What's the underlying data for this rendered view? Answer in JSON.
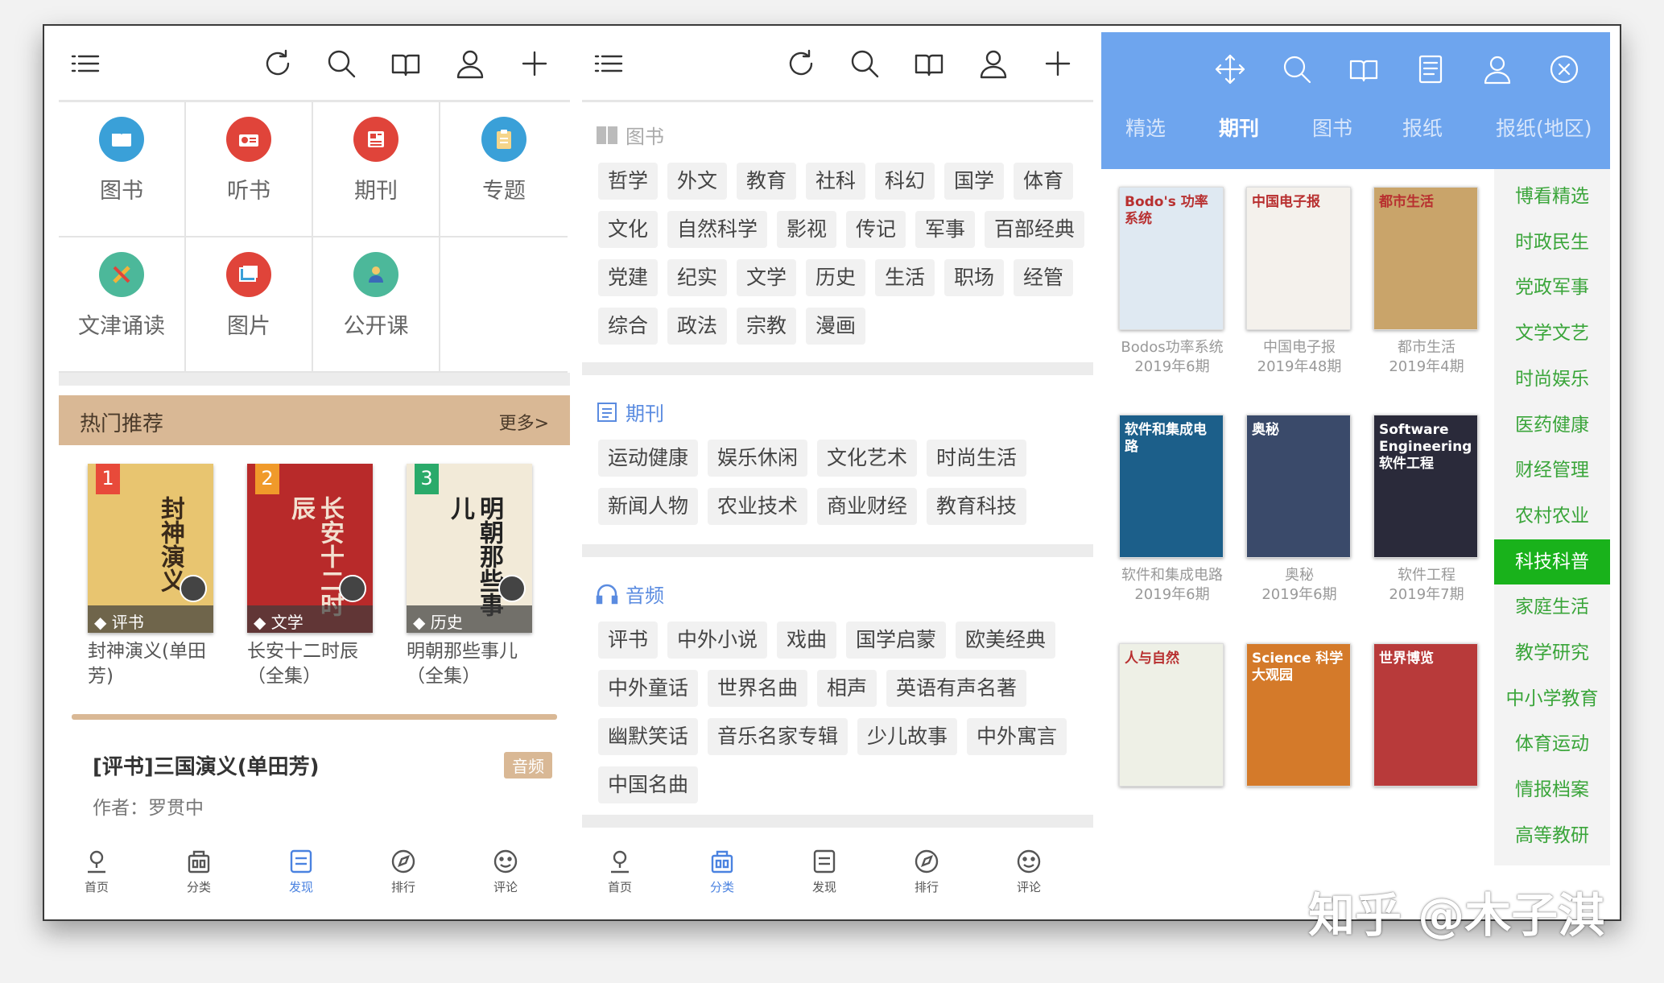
{
  "panel1": {
    "grid": [
      {
        "label": "图书",
        "color": "#3aa0d8",
        "icon": "book-icon"
      },
      {
        "label": "听书",
        "color": "#e0443a",
        "icon": "radio-icon"
      },
      {
        "label": "期刊",
        "color": "#e0443a",
        "icon": "newspaper-icon"
      },
      {
        "label": "专题",
        "color": "#3aa0d8",
        "icon": "clipboard-icon"
      },
      {
        "label": "文津诵读",
        "color": "#4cb89a",
        "icon": "brush-icon"
      },
      {
        "label": "图片",
        "color": "#e0443a",
        "icon": "picture-icon"
      },
      {
        "label": "公开课",
        "color": "#4cb89a",
        "icon": "teacher-icon"
      }
    ],
    "hot": {
      "title": "热门推荐",
      "more": "更多>"
    },
    "books": [
      {
        "rank": "1",
        "tag": "评书",
        "title": "封神演义(单田芳)",
        "cover_text": "封神演义",
        "rank_color": "#e84a3a",
        "cover_color": "#e8c570"
      },
      {
        "rank": "2",
        "tag": "文学",
        "title": "长安十二时辰（全集）",
        "cover_text": "长安十二时辰",
        "rank_color": "#f09a2a",
        "cover_color": "#b82a2a"
      },
      {
        "rank": "3",
        "tag": "历史",
        "title": "明朝那些事儿（全集）",
        "cover_text": "明朝那些事儿",
        "rank_color": "#2aaa6a",
        "cover_color": "#f2ead8"
      }
    ],
    "featured": {
      "title": "[评书]三国演义(单田芳)",
      "author": "作者：罗贯中",
      "tag": "音频"
    }
  },
  "nav": [
    {
      "label": "首页",
      "icon": "home-icon"
    },
    {
      "label": "分类",
      "icon": "category-icon"
    },
    {
      "label": "发现",
      "icon": "discover-icon"
    },
    {
      "label": "排行",
      "icon": "ranking-icon"
    },
    {
      "label": "评论",
      "icon": "comment-icon"
    }
  ],
  "panel2": {
    "sections": [
      {
        "title": "图书",
        "color": "#aaaaaa",
        "rows": [
          [
            "哲学",
            "外文",
            "教育",
            "社科",
            "科幻",
            "国学",
            "体育"
          ],
          [
            "文化",
            "自然科学",
            "影视",
            "传记",
            "军事",
            "百部经典"
          ],
          [
            "党建",
            "纪实",
            "文学",
            "历史",
            "生活",
            "职场",
            "经管"
          ],
          [
            "综合",
            "政法",
            "宗教",
            "漫画"
          ]
        ]
      },
      {
        "title": "期刊",
        "color": "#5a8be0",
        "rows": [
          [
            "运动健康",
            "娱乐休闲",
            "文化艺术",
            "时尚生活"
          ],
          [
            "新闻人物",
            "农业技术",
            "商业财经",
            "教育科技"
          ]
        ]
      },
      {
        "title": "音频",
        "color": "#5a8be0",
        "rows": [
          [
            "评书",
            "中外小说",
            "戏曲",
            "国学启蒙",
            "欧美经典"
          ],
          [
            "中外童话",
            "世界名曲",
            "相声",
            "英语有声名著"
          ],
          [
            "幽默笑话",
            "音乐名家专辑",
            "少儿故事",
            "中外寓言"
          ],
          [
            "中国名曲"
          ]
        ]
      }
    ]
  },
  "panel3": {
    "tabs": [
      "精选",
      "期刊",
      "图书",
      "报纸",
      "报纸(地区)"
    ],
    "active_tab": "期刊",
    "magazines": [
      {
        "name": "Bodos功率系统",
        "issue": "2019年6期",
        "cover_text": "Bodo's 功率系统",
        "color": "#dfe9f2"
      },
      {
        "name": "中国电子报",
        "issue": "2019年48期",
        "cover_text": "中国电子报",
        "color": "#f4f1ec"
      },
      {
        "name": "都市生活",
        "issue": "2019年4期",
        "cover_text": "都市生活",
        "color": "#c9a46a"
      },
      {
        "name": "软件和集成电路",
        "issue": "2019年6期",
        "cover_text": "软件和集成电路",
        "color": "#1c5f8a"
      },
      {
        "name": "奥秘",
        "issue": "2019年6期",
        "cover_text": "奥秘",
        "color": "#3a4a6a"
      },
      {
        "name": "软件工程",
        "issue": "2019年7期",
        "cover_text": "Software Engineering 软件工程",
        "color": "#2a2a3a"
      },
      {
        "name": "",
        "issue": "",
        "cover_text": "人与自然",
        "color": "#eef0e6"
      },
      {
        "name": "",
        "issue": "",
        "cover_text": "Science 科学大观园",
        "color": "#d47a2a"
      },
      {
        "name": "",
        "issue": "",
        "cover_text": "世界博览",
        "color": "#b83a3a"
      }
    ],
    "categories": [
      "博看精选",
      "时政民生",
      "党政军事",
      "文学文艺",
      "时尚娱乐",
      "医药健康",
      "财经管理",
      "农村农业",
      "科技科普",
      "家庭生活",
      "教学研究",
      "中小学教育",
      "体育运动",
      "情报档案",
      "高等教研"
    ],
    "active_category": "科技科普"
  },
  "watermark": "知乎 @木子淇"
}
